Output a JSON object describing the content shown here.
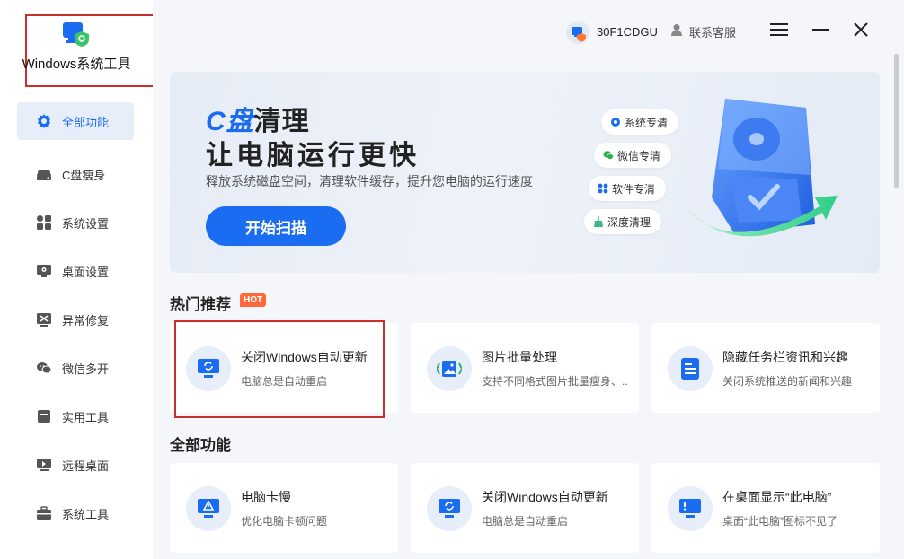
{
  "app": {
    "title": "Windows系统工具"
  },
  "colors": {
    "accent": "#1a6cf0",
    "highlight_box": "#c9302c",
    "hot_badge": "#ff6a3d"
  },
  "sidebar": {
    "items": [
      {
        "label": "全部功能",
        "icon": "gear-icon",
        "active": true
      },
      {
        "label": "C盘瘦身",
        "icon": "disk-icon"
      },
      {
        "label": "系统设置",
        "icon": "grid-settings-icon"
      },
      {
        "label": "桌面设置",
        "icon": "desktop-settings-icon"
      },
      {
        "label": "异常修复",
        "icon": "repair-icon"
      },
      {
        "label": "微信多开",
        "icon": "wechat-icon"
      },
      {
        "label": "实用工具",
        "icon": "toolbox-icon"
      },
      {
        "label": "远程桌面",
        "icon": "remote-desktop-icon"
      },
      {
        "label": "系统工具",
        "icon": "briefcase-icon"
      }
    ]
  },
  "titlebar": {
    "user_id": "30F1CDGU",
    "support_label": "联系客服"
  },
  "banner": {
    "title_accent": "C盘",
    "title_rest": "清理",
    "title_line2": "让电脑运行更快",
    "description": "释放系统磁盘空间，清理软件缓存，提升您电脑的运行速度",
    "scan_button": "开始扫描",
    "chips": [
      "系统专清",
      "微信专清",
      "软件专清",
      "深度清理"
    ]
  },
  "hot": {
    "title": "热门推荐",
    "badge": "HOT",
    "cards": [
      {
        "title": "关闭Windows自动更新",
        "subtitle": "电脑总是自动重启",
        "icon": "monitor-refresh-icon"
      },
      {
        "title": "图片批量处理",
        "subtitle": "支持不同格式图片批量瘦身、..",
        "icon": "image-batch-icon"
      },
      {
        "title": "隐藏任务栏资讯和兴趣",
        "subtitle": "关闭系统推送的新闻和兴趣",
        "icon": "news-icon"
      }
    ]
  },
  "all": {
    "title": "全部功能",
    "cards": [
      {
        "title": "电脑卡慢",
        "subtitle": "优化电脑卡顿问题",
        "icon": "monitor-warning-icon"
      },
      {
        "title": "关闭Windows自动更新",
        "subtitle": "电脑总是自动重启",
        "icon": "monitor-refresh-icon"
      },
      {
        "title": "在桌面显示“此电脑”",
        "subtitle": "桌面“此电脑”图标不见了",
        "icon": "monitor-alert-icon"
      }
    ]
  }
}
